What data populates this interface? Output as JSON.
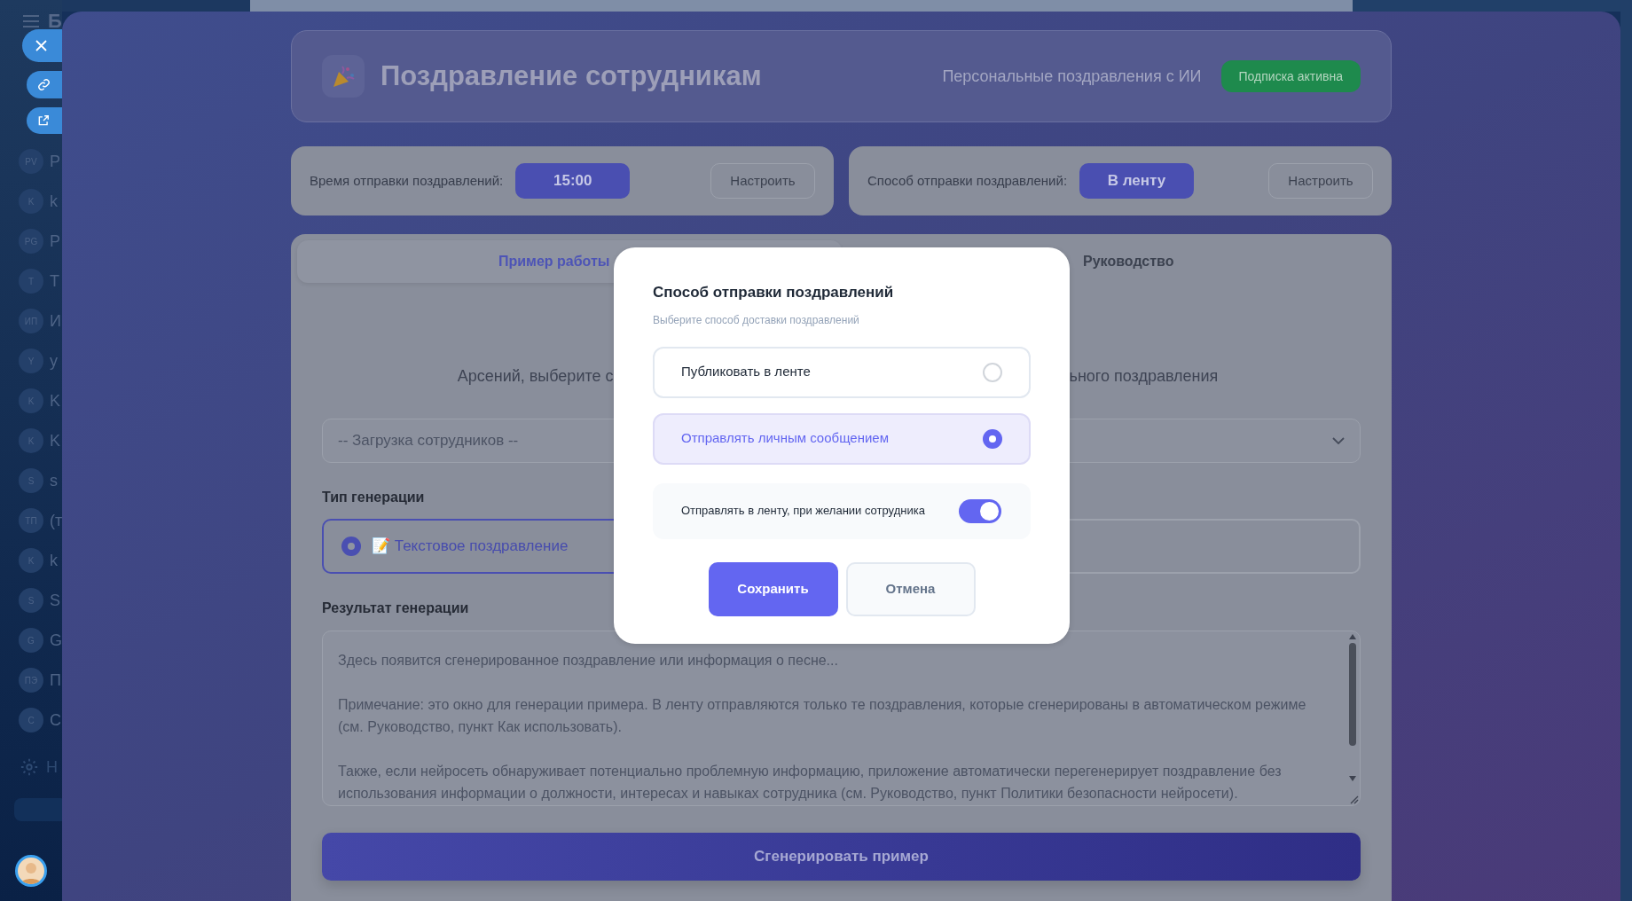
{
  "sidebar": {
    "title": "Б",
    "items": [
      {
        "initials": "PV",
        "label": "P"
      },
      {
        "initials": "K",
        "label": "k"
      },
      {
        "initials": "PG",
        "label": "P"
      },
      {
        "initials": "T",
        "label": "T"
      },
      {
        "initials": "ИП",
        "label": "И"
      },
      {
        "initials": "Y",
        "label": "y"
      },
      {
        "initials": "K",
        "label": "K"
      },
      {
        "initials": "K",
        "label": "K"
      },
      {
        "initials": "S",
        "label": "s"
      },
      {
        "initials": "ТП",
        "label": "(т"
      },
      {
        "initials": "K",
        "label": "k"
      },
      {
        "initials": "S",
        "label": "S"
      },
      {
        "initials": "G",
        "label": "G"
      },
      {
        "initials": "ПЭ",
        "label": "П"
      },
      {
        "initials": "С",
        "label": "С"
      }
    ],
    "settings_label": "Н"
  },
  "header": {
    "title": "Поздравление сотрудникам",
    "subtitle": "Персональные поздравления с ИИ",
    "badge": "Подписка активна"
  },
  "settings": [
    {
      "label": "Время отправки поздравлений:",
      "value": "15:00",
      "button": "Настроить"
    },
    {
      "label": "Способ отправки поздравлений:",
      "value": "В ленту",
      "button": "Настроить"
    }
  ],
  "tabs": [
    {
      "label": "Пример работы",
      "selected": true
    },
    {
      "label": "Руководство",
      "selected": false
    }
  ],
  "prompt_fragments": [
    "Арсений, выберите с",
    "ьного поздравления"
  ],
  "employee_select": {
    "value": "-- Загрузка сотрудников --"
  },
  "generation_type": {
    "label": "Тип генерации",
    "options": [
      {
        "label": "📝 Текстовое поздравление",
        "selected": true
      },
      {
        "selected": false
      }
    ]
  },
  "result": {
    "label": "Результат генерации",
    "placeholder": "Здесь появится сгенерированное поздравление или информация о песне...\n\nПримечание: это окно для генерации примера. В ленту отправляются только те поздравления, которые сгенерированы в автоматическом режиме (см. Руководство, пункт Как использовать).\n\nТакже, если нейросеть обнаруживает потенциально проблемную информацию, приложение автоматически перегенерирует поздравление без использования информации о должности, интересах и навыках сотрудника (см. Руководство, пункт Политики безопасности нейросети)."
  },
  "generate_button": "Сгенерировать пример",
  "modal": {
    "title": "Способ отправки поздравлений",
    "subtitle": "Выберите способ доставки поздравлений",
    "options": [
      {
        "label": "Публиковать в ленте",
        "selected": false
      },
      {
        "label": "Отправлять личным сообщением",
        "selected": true
      }
    ],
    "toggle": {
      "label": "Отправлять в ленту, при желании сотрудника",
      "on": true
    },
    "buttons": [
      {
        "label": "Сохранить",
        "kind": "primary"
      },
      {
        "label": "Отмена",
        "kind": "secondary"
      }
    ]
  }
}
